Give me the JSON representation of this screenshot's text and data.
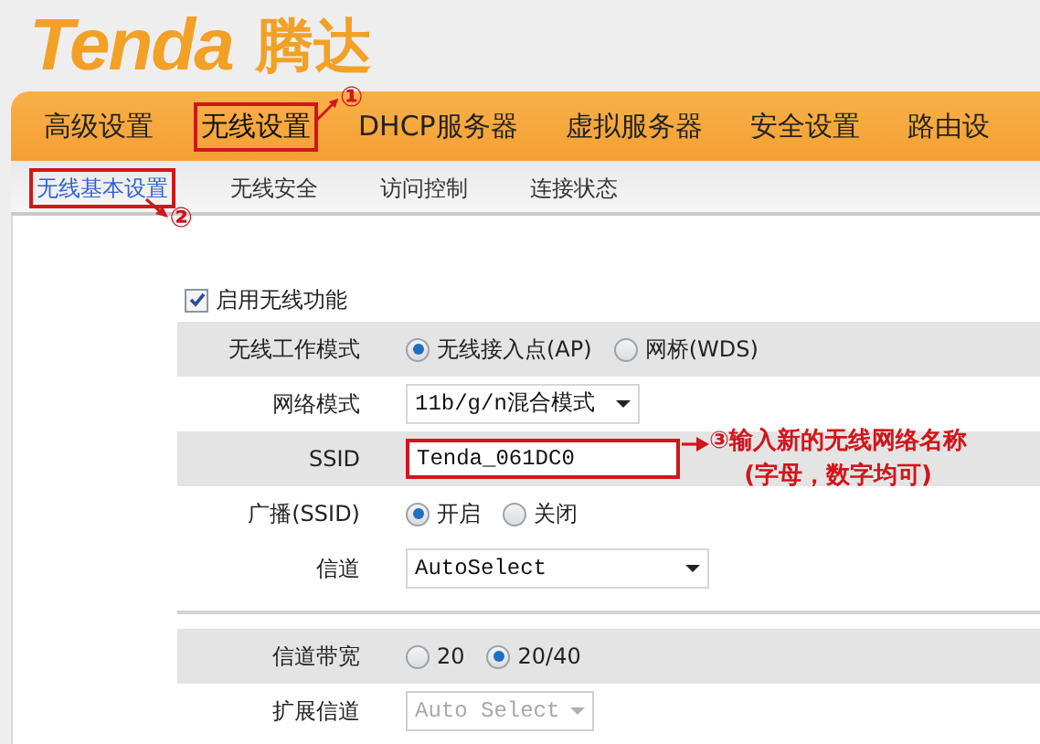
{
  "logo": {
    "brand": "Tenda",
    "brand_cn": "腾达"
  },
  "nav": {
    "tabs": [
      {
        "label": "高级设置",
        "selected": false
      },
      {
        "label": "无线设置",
        "selected": true,
        "callout": "①"
      },
      {
        "label": "DHCP服务器",
        "selected": false
      },
      {
        "label": "虚拟服务器",
        "selected": false
      },
      {
        "label": "安全设置",
        "selected": false
      },
      {
        "label": "路由设",
        "selected": false
      }
    ]
  },
  "subnav": {
    "tabs": [
      {
        "label": "无线基本设置",
        "selected": true,
        "callout": "②"
      },
      {
        "label": "无线安全",
        "selected": false
      },
      {
        "label": "访问控制",
        "selected": false
      },
      {
        "label": "连接状态",
        "selected": false
      }
    ]
  },
  "enable_wireless": {
    "label": "启用无线功能",
    "checked": true
  },
  "groups": [
    {
      "rows": [
        {
          "kind": "radio",
          "label": "无线工作模式",
          "shaded": true,
          "options": [
            {
              "label": "无线接入点(AP)",
              "selected": true
            },
            {
              "label": "网桥(WDS)",
              "selected": false
            }
          ]
        },
        {
          "kind": "select",
          "label": "网络模式",
          "shaded": false,
          "value": "11b/g/n混合模式",
          "disabled": false
        },
        {
          "kind": "text",
          "label": "SSID",
          "shaded": true,
          "value": "Tenda_061DC0",
          "callout": "③输入新的无线网络名称",
          "callout_note": "(字母，数字均可)"
        },
        {
          "kind": "radio",
          "label": "广播(SSID)",
          "shaded": false,
          "options": [
            {
              "label": "开启",
              "selected": true
            },
            {
              "label": "关闭",
              "selected": false
            }
          ]
        },
        {
          "kind": "select",
          "label": "信道",
          "shaded": false,
          "value": "AutoSelect",
          "disabled": false
        }
      ]
    },
    {
      "rows": [
        {
          "kind": "radio",
          "label": "信道带宽",
          "shaded": true,
          "options": [
            {
              "label": "20",
              "selected": false
            },
            {
              "label": "20/40",
              "selected": true
            }
          ]
        },
        {
          "kind": "select",
          "label": "扩展信道",
          "shaded": false,
          "value": "Auto Select",
          "disabled": true
        }
      ]
    }
  ]
}
